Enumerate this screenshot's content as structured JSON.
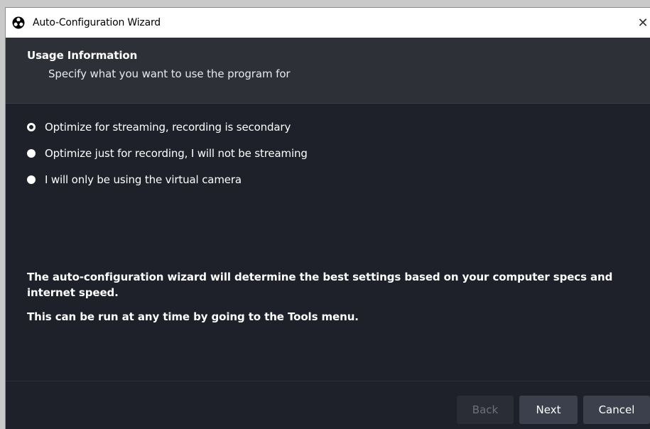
{
  "window": {
    "title": "Auto-Configuration Wizard",
    "app_icon": "obs-logo-icon",
    "close_glyph": "✕"
  },
  "header": {
    "title": "Usage Information",
    "subtitle": "Specify what you want to use the program for"
  },
  "options": [
    {
      "label": "Optimize for streaming, recording is secondary",
      "selected": true
    },
    {
      "label": "Optimize just for recording, I will not be streaming",
      "selected": false
    },
    {
      "label": "I will only be using the virtual camera",
      "selected": false
    }
  ],
  "info": {
    "line1": "The auto-configuration wizard will determine the best settings based on your computer specs and internet speed.",
    "line2": "This can be run at any time by going to the Tools menu."
  },
  "buttons": {
    "back": "Back",
    "next": "Next",
    "cancel": "Cancel"
  },
  "colors": {
    "background": "#1e212a",
    "header": "#2e3038",
    "button": "#3c404d",
    "button_disabled": "#2a2d36"
  }
}
